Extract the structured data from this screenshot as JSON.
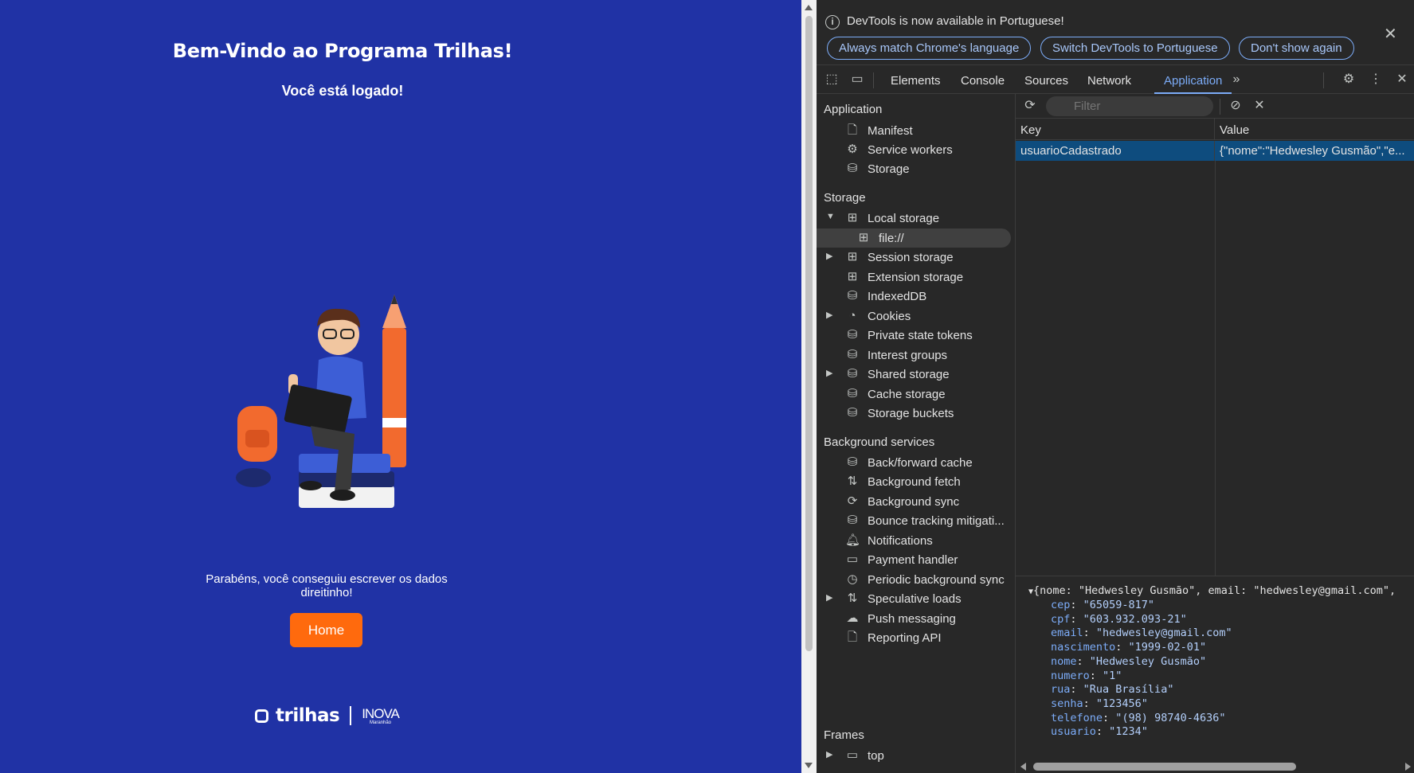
{
  "page": {
    "title": "Bem-Vindo ao Programa Trilhas!",
    "subtitle": "Você está logado!",
    "congrats": "Parabéns, você conseguiu escrever os dados direitinho!",
    "home_button": "Home",
    "brand_name": "trilhas",
    "brand_partner": "INOVA",
    "brand_partner_sub": "Maranhão",
    "colors": {
      "background": "#2032a5",
      "accent": "#ff6a0d"
    }
  },
  "devtools": {
    "infobar": {
      "message": "DevTools is now available in Portuguese!",
      "buttons": [
        "Always match Chrome's language",
        "Switch DevTools to Portuguese",
        "Don't show again"
      ]
    },
    "tabs": [
      "Elements",
      "Console",
      "Sources",
      "Network",
      "Application"
    ],
    "active_tab": "Application",
    "sidebar": {
      "application_header": "Application",
      "application_items": [
        "Manifest",
        "Service workers",
        "Storage"
      ],
      "storage_header": "Storage",
      "storage_items": [
        "Local storage",
        "file://",
        "Session storage",
        "Extension storage",
        "IndexedDB",
        "Cookies",
        "Private state tokens",
        "Interest groups",
        "Shared storage",
        "Cache storage",
        "Storage buckets"
      ],
      "background_header": "Background services",
      "background_items": [
        "Back/forward cache",
        "Background fetch",
        "Background sync",
        "Bounce tracking mitigati...",
        "Notifications",
        "Payment handler",
        "Periodic background sync",
        "Speculative loads",
        "Push messaging",
        "Reporting API"
      ],
      "frames_header": "Frames",
      "frames_items": [
        "top"
      ]
    },
    "filter_placeholder": "Filter",
    "table": {
      "headers": [
        "Key",
        "Value"
      ],
      "rows": [
        {
          "key": "usuarioCadastrado",
          "value": "{\"nome\":\"Hedwesley Gusmão\",\"e..."
        }
      ]
    },
    "preview": {
      "header": "{nome: \"Hedwesley Gusmão\", email: \"hedwesley@gmail.com\",",
      "fields": [
        {
          "k": "cep",
          "v": "\"65059-817\""
        },
        {
          "k": "cpf",
          "v": "\"603.932.093-21\""
        },
        {
          "k": "email",
          "v": "\"hedwesley@gmail.com\""
        },
        {
          "k": "nascimento",
          "v": "\"1999-02-01\""
        },
        {
          "k": "nome",
          "v": "\"Hedwesley Gusmão\""
        },
        {
          "k": "numero",
          "v": "\"1\""
        },
        {
          "k": "rua",
          "v": "\"Rua Brasília\""
        },
        {
          "k": "senha",
          "v": "\"123456\""
        },
        {
          "k": "telefone",
          "v": "\"(98) 98740-4636\""
        },
        {
          "k": "usuario",
          "v": "\"1234\""
        }
      ]
    },
    "colors": {
      "active_tab": "#7cacf8",
      "selected_row": "#0e4c7e",
      "panel": "#282828"
    }
  }
}
